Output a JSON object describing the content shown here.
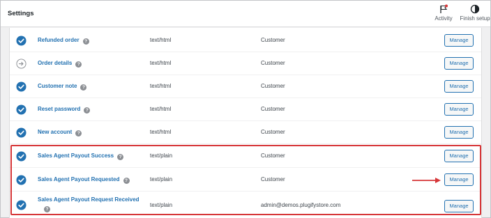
{
  "header": {
    "title": "Settings",
    "activity_label": "Activity",
    "finish_label": "Finish setup"
  },
  "emails": [
    {
      "name": "Refunded order",
      "content_type": "text/html",
      "recipient": "Customer",
      "status": "enabled",
      "action": "Manage"
    },
    {
      "name": "Order details",
      "content_type": "text/html",
      "recipient": "Customer",
      "status": "manual",
      "action": "Manage"
    },
    {
      "name": "Customer note",
      "content_type": "text/html",
      "recipient": "Customer",
      "status": "enabled",
      "action": "Manage"
    },
    {
      "name": "Reset password",
      "content_type": "text/html",
      "recipient": "Customer",
      "status": "enabled",
      "action": "Manage"
    },
    {
      "name": "New account",
      "content_type": "text/html",
      "recipient": "Customer",
      "status": "enabled",
      "action": "Manage"
    },
    {
      "name": "Sales Agent Payout Success",
      "content_type": "text/plain",
      "recipient": "Customer",
      "status": "enabled",
      "action": "Manage"
    },
    {
      "name": "Sales Agent Payout Requested",
      "content_type": "text/plain",
      "recipient": "Customer",
      "status": "enabled",
      "action": "Manage"
    },
    {
      "name": "Sales Agent Payout Request Received",
      "content_type": "text/plain",
      "recipient": "admin@demos.plugifystore.com",
      "status": "enabled",
      "action": "Manage"
    }
  ],
  "help_glyph": "?",
  "colors": {
    "accent": "#2271b1",
    "highlight": "#d63638",
    "flag": "#d63638"
  }
}
